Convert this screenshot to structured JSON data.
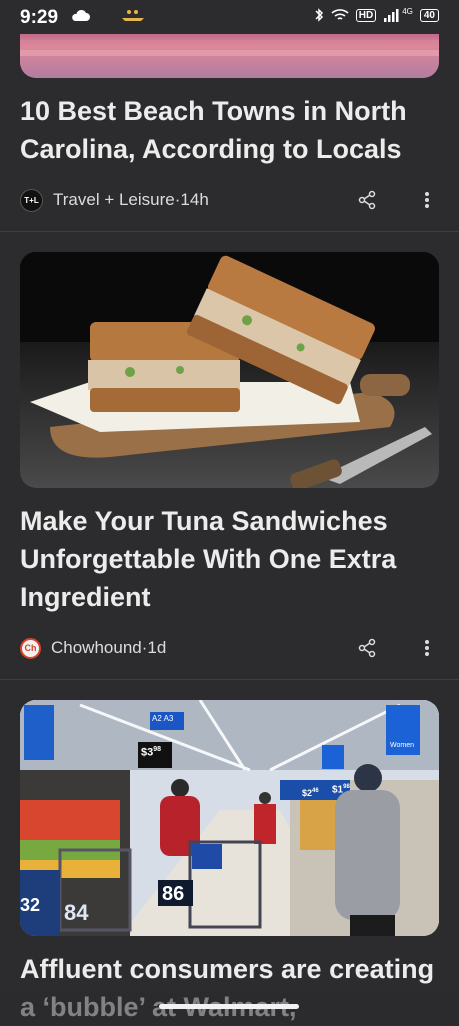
{
  "status_bar": {
    "time": "9:29",
    "hd_label": "HD",
    "network": "4G",
    "battery": "40"
  },
  "articles": [
    {
      "title": "10 Best Beach Towns in North Carolina, According to Locals",
      "source": "Travel + Leisure",
      "age": "14h",
      "logo_text": "T+L"
    },
    {
      "title": "Make Your Tuna Sandwiches Unforgettable With One Extra Ingredient",
      "source": "Chowhound",
      "age": "1d",
      "logo_text": "Ch"
    },
    {
      "title": "Affluent consumers are creating a ‘bubble’ at Walmart,",
      "store_signs": {
        "price1": "$3",
        "price1_cents": "98",
        "price2": "$1",
        "price2_cents": "98",
        "price3": "$2",
        "price3_cents": "46",
        "num1": "84",
        "num2": "86",
        "num3": "32",
        "aisle_a2": "A2",
        "aisle_a3": "A3",
        "women_sign": "Women"
      }
    }
  ],
  "separator": " · ",
  "icons": {
    "share": "share-icon",
    "more": "more-vert-icon"
  }
}
